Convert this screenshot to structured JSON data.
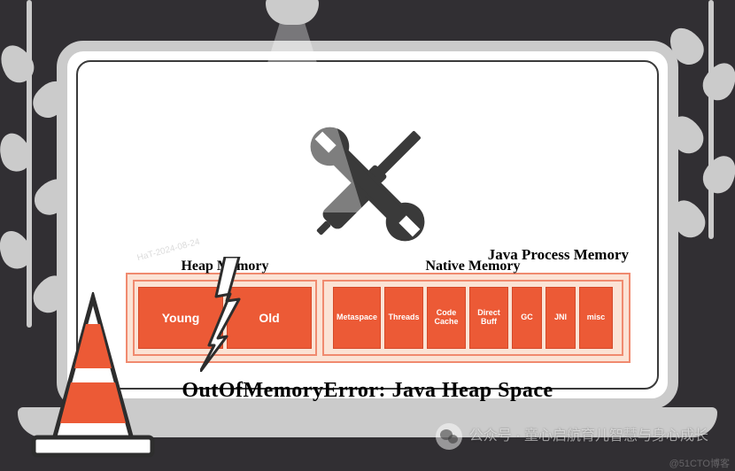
{
  "title": "Java Process Memory",
  "heap": {
    "label": "Heap Memory",
    "cells": [
      "Young",
      "Old"
    ]
  },
  "native": {
    "label": "Native Memory",
    "cells": [
      "Metaspace",
      "Threads",
      "Code\nCache",
      "Direct\nBuff",
      "GC",
      "JNI",
      "misc"
    ]
  },
  "error": "OutOfMemoryError: Java Heap Space",
  "watermark_date": "HaT-2024-08-24",
  "watermark_site": "@51CTO博客",
  "wechat": "公众号 · 童心启航育儿智慧与身心成长"
}
